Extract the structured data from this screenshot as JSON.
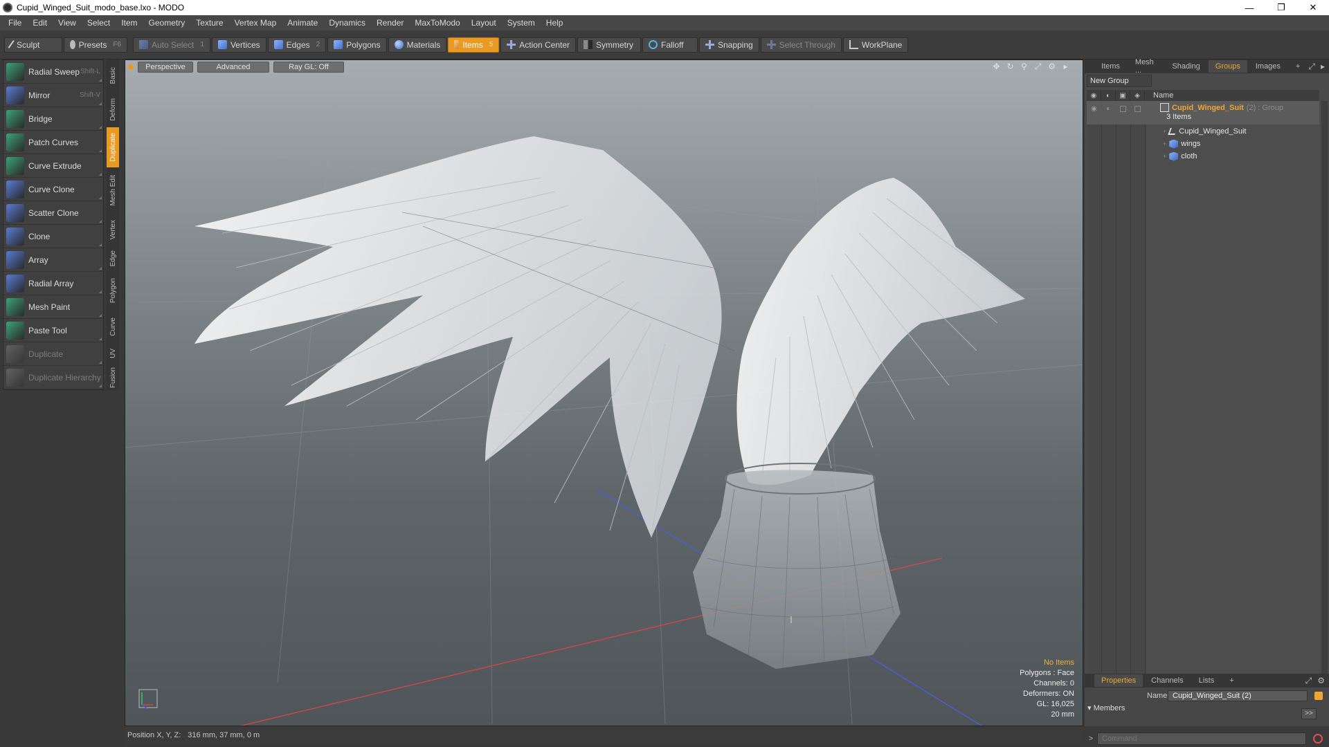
{
  "window": {
    "title": "Cupid_Winged_Suit_modo_base.lxo - MODO",
    "controls": [
      "—",
      "❐",
      "✕"
    ]
  },
  "menu": [
    "File",
    "Edit",
    "View",
    "Select",
    "Item",
    "Geometry",
    "Texture",
    "Vertex Map",
    "Animate",
    "Dynamics",
    "Render",
    "MaxToModo",
    "Layout",
    "System",
    "Help"
  ],
  "toolbar": {
    "sculpt": "Sculpt",
    "presets": "Presets",
    "presets_key": "F6",
    "auto_select": "Auto Select",
    "vertices": "Vertices",
    "vertices_num": "1",
    "edges": "Edges",
    "edges_num": "2",
    "polygons": "Polygons",
    "materials": "Materials",
    "items": "Items",
    "items_num": "5",
    "action_center": "Action Center",
    "symmetry": "Symmetry",
    "falloff": "Falloff",
    "snapping": "Snapping",
    "select_through": "Select Through",
    "workplane": "WorkPlane"
  },
  "tools": [
    {
      "label": "Radial Sweep",
      "key": "Shift-L",
      "icon": "radial-sweep-icon",
      "color": "#3aa37a"
    },
    {
      "label": "Mirror",
      "key": "Shift-V",
      "icon": "mirror-icon",
      "color": "#5a7bd6"
    },
    {
      "label": "Bridge",
      "key": "",
      "icon": "bridge-icon",
      "color": "#3aa37a"
    },
    {
      "label": "Patch Curves",
      "key": "",
      "icon": "patch-curves-icon",
      "color": "#3aa37a"
    },
    {
      "label": "Curve Extrude",
      "key": "",
      "icon": "curve-extrude-icon",
      "color": "#3aa37a"
    },
    {
      "label": "Curve Clone",
      "key": "",
      "icon": "curve-clone-icon",
      "color": "#5a7bd6"
    },
    {
      "label": "Scatter Clone",
      "key": "",
      "icon": "scatter-clone-icon",
      "color": "#5a7bd6"
    },
    {
      "label": "Clone",
      "key": "",
      "icon": "clone-icon",
      "color": "#5a7bd6"
    },
    {
      "label": "Array",
      "key": "",
      "icon": "array-icon",
      "color": "#5a7bd6"
    },
    {
      "label": "Radial Array",
      "key": "",
      "icon": "radial-array-icon",
      "color": "#5a7bd6"
    },
    {
      "label": "Mesh Paint",
      "key": "",
      "icon": "mesh-paint-icon",
      "color": "#3aa37a"
    },
    {
      "label": "Paste Tool",
      "key": "",
      "icon": "paste-tool-icon",
      "color": "#3aa37a"
    },
    {
      "label": "Duplicate",
      "key": "",
      "icon": "duplicate-icon",
      "color": "#888888",
      "disabled": true
    },
    {
      "label": "Duplicate Hierarchy",
      "key": "",
      "icon": "duplicate-hierarchy-icon",
      "color": "#888888",
      "disabled": true
    }
  ],
  "vtabs": [
    "Basic",
    "Deform",
    "Duplicate",
    "Mesh Edit",
    "Vertex",
    "Edge",
    "Polygon",
    "Curve",
    "UV",
    "Fusion"
  ],
  "vtab_active": "Duplicate",
  "viewport": {
    "tabs": [
      "Perspective",
      "Advanced",
      "Ray GL: Off"
    ],
    "info": {
      "no_items": "No Items",
      "polygons": "Polygons : Face",
      "channels": "Channels: 0",
      "deformers": "Deformers: ON",
      "gl": "GL: 16,025",
      "scale": "20 mm"
    }
  },
  "status": {
    "label": "Position X, Y, Z:",
    "value": "316 mm, 37 mm, 0 m"
  },
  "right_tabs": [
    "Items",
    "Mesh ...",
    "Shading",
    "Groups",
    "Images"
  ],
  "right_tab_active": "Groups",
  "groups": {
    "new_group": "New Group",
    "name_header": "Name",
    "group_name": "Cupid_Winged_Suit",
    "group_suffix": "(2) : Group",
    "group_count": "3 Items",
    "children": [
      "Cupid_Winged_Suit",
      "wings",
      "cloth"
    ]
  },
  "props_tabs": [
    "Properties",
    "Channels",
    "Lists"
  ],
  "props": {
    "name_label": "Name",
    "name_value": "Cupid_Winged_Suit (2)",
    "members": "Members",
    "more": ">>"
  },
  "command": {
    "placeholder": "Command"
  },
  "colors": {
    "accent": "#e89a22",
    "group_text": "#f0a534"
  }
}
